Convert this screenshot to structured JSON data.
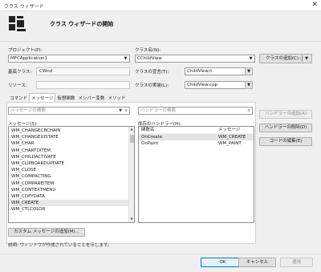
{
  "window": {
    "title": "クラス ウィザード",
    "heading": "クラス ウィザードの開始"
  },
  "project": {
    "label": "プロジェクト(P):",
    "value": "MFCApplication1"
  },
  "class_name": {
    "label": "クラス名(N):",
    "value": "CChildView"
  },
  "add_class_button": "クラスの追加(C)...",
  "base_class": {
    "label": "基底クラス:",
    "value": "CWnd"
  },
  "class_declaration": {
    "label": "クラスの宣言(T):",
    "value": "ChildView.h"
  },
  "resource": {
    "label": "リソース:",
    "value": ""
  },
  "class_implementation": {
    "label": "クラスの実装(L):",
    "value": "ChildView.cpp"
  },
  "tabs": [
    {
      "label": "コマンド",
      "active": false
    },
    {
      "label": "メッセージ",
      "active": true
    },
    {
      "label": "仮想関数",
      "active": false
    },
    {
      "label": "メンバー変数",
      "active": false
    },
    {
      "label": "メソッド",
      "active": false
    }
  ],
  "message_search": {
    "placeholder": "メッセージの検索"
  },
  "handler_search": {
    "placeholder": "ハンドラーの検索"
  },
  "messages": {
    "label": "メッセージ(S):",
    "items": [
      "WM_CHANGECBCHAIN",
      "WM_CHANGEUISTATE",
      "WM_CHAR",
      "WM_CHARTOITEM",
      "WM_CHILDACTIVATE",
      "WM_CLIPBOARDUPDATE",
      "WM_CLOSE",
      "WM_COMPACTING",
      "WM_COMPAREITEM",
      "WM_CONTEXTMENU",
      "WM_COPYDATA",
      "WM_CREATE",
      "WM_CTLCOLOR"
    ],
    "selected": "WM_CREATE"
  },
  "handlers": {
    "label": "既存のハンドラー(H):",
    "col_function": "関数名",
    "col_message": "メッセージ",
    "rows": [
      {
        "function": "OnCreate",
        "message": "WM_CREATE"
      },
      {
        "function": "OnPaint",
        "message": "WM_PAINT"
      }
    ]
  },
  "buttons": {
    "add_handler": "ハンドラーの追加(A)",
    "delete_handler": "ハンドラーの削除(D)",
    "edit_code": "コードの編集(E)",
    "custom_message": "カスタム メッセージの追加(M)...",
    "ok": "OK",
    "cancel": "キャンセル",
    "apply": "適用"
  },
  "description": "説明:  ウィンドウが作成されていることを示します。",
  "colors": {
    "accent": "#0078d7",
    "selection": "#e7e7e7"
  }
}
